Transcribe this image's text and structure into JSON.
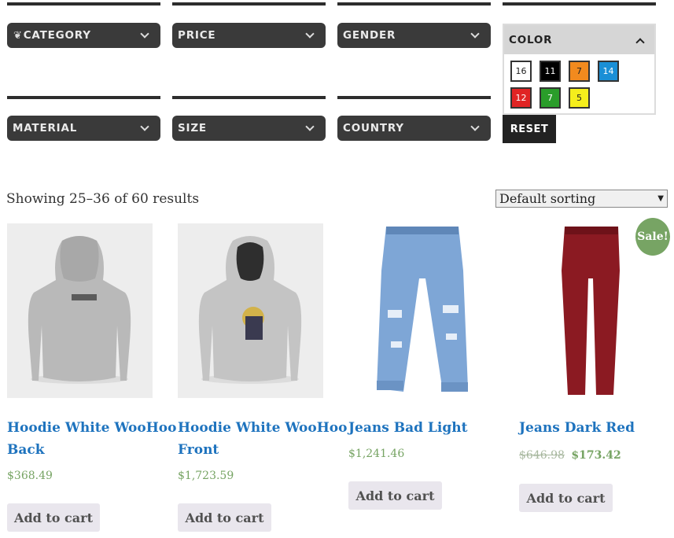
{
  "filters": {
    "row1": [
      {
        "label": "CATEGORY",
        "icon": "leaf-icon"
      },
      {
        "label": "PRICE"
      },
      {
        "label": "GENDER"
      }
    ],
    "row2": [
      {
        "label": "MATERIAL"
      },
      {
        "label": "SIZE"
      },
      {
        "label": "COUNTRY"
      }
    ],
    "color": {
      "label": "COLOR",
      "swatches": [
        {
          "count": "16",
          "color": "#ffffff",
          "text_color": "#222222"
        },
        {
          "count": "11",
          "color": "#000000",
          "text_color": "#ffffff"
        },
        {
          "count": "7",
          "color": "#f28a1e",
          "text_color": "#222222"
        },
        {
          "count": "14",
          "color": "#1a8fd6",
          "text_color": "#ffffff"
        },
        {
          "count": "12",
          "color": "#e02424",
          "text_color": "#ffffff"
        },
        {
          "count": "7",
          "color": "#2a9d2a",
          "text_color": "#ffffff"
        },
        {
          "count": "5",
          "color": "#f5ee1c",
          "text_color": "#222222"
        }
      ]
    },
    "reset_label": "RESET"
  },
  "results": {
    "count_text": "Showing 25–36 of 60 results",
    "sort_value": "Default sorting"
  },
  "products": [
    {
      "title_line1": "Hoodie White WooHoo",
      "title_line2": "Back",
      "price": "$368.49",
      "cart_label": "Add to cart"
    },
    {
      "title_line1": "Hoodie White WooHoo",
      "title_line2": "Front",
      "price": "$1,723.59",
      "cart_label": "Add to cart"
    },
    {
      "title_line1": "Jeans Bad Light",
      "price": "$1,241.46",
      "cart_label": "Add to cart"
    },
    {
      "title_line1": "Jeans Dark Red",
      "price_old": "$646.98",
      "price": "$173.42",
      "cart_label": "Add to cart",
      "badge": "Sale!"
    }
  ],
  "colors": {
    "filter_bg": "#3a3a3a",
    "link": "#1e73be",
    "price": "#77a464",
    "sale_badge": "#77a464"
  }
}
